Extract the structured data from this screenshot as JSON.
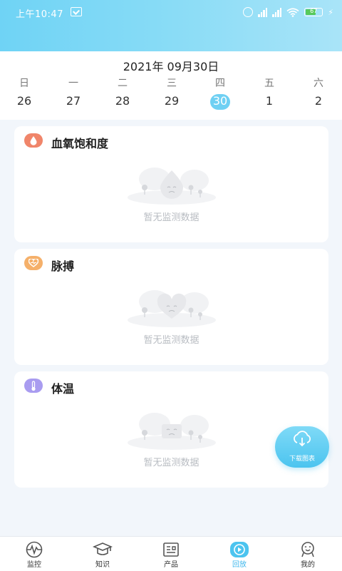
{
  "status_bar": {
    "time": "上午10:47",
    "battery": "67"
  },
  "calendar": {
    "title": "2021年 09月30日",
    "weekdays": [
      "日",
      "一",
      "二",
      "三",
      "四",
      "五",
      "六"
    ],
    "days": [
      "26",
      "27",
      "28",
      "29",
      "30",
      "1",
      "2"
    ],
    "selected_index": 4
  },
  "cards": [
    {
      "title": "血氧饱和度",
      "empty_text": "暂无监测数据",
      "icon": "blood-drop-icon"
    },
    {
      "title": "脉搏",
      "empty_text": "暂无监测数据",
      "icon": "heart-icon"
    },
    {
      "title": "体温",
      "empty_text": "暂无监测数据",
      "icon": "thermometer-icon"
    }
  ],
  "fab": {
    "label": "下载图表",
    "icon": "cloud-download-icon"
  },
  "tabs": [
    {
      "label": "监控",
      "icon": "monitor-pulse-icon"
    },
    {
      "label": "知识",
      "icon": "graduation-cap-icon"
    },
    {
      "label": "产品",
      "icon": "newspaper-icon"
    },
    {
      "label": "回放",
      "icon": "play-icon"
    },
    {
      "label": "我的",
      "icon": "profile-icon"
    }
  ],
  "active_tab": 3,
  "colors": {
    "accent": "#4cc4ef",
    "header": "#86dbf6"
  }
}
